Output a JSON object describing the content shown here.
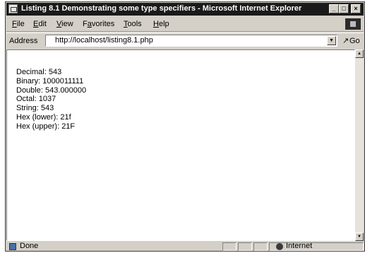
{
  "window": {
    "title": "Listing 8.1 Demonstrating some type specifiers - Microsoft Internet Explorer",
    "controls": {
      "minimize": "_",
      "maximize": "□",
      "close": "×"
    }
  },
  "menu": [
    {
      "label": "File",
      "mnemonic": "F",
      "rest": "ile"
    },
    {
      "label": "Edit",
      "mnemonic": "E",
      "rest": "dit"
    },
    {
      "label": "View",
      "mnemonic": "V",
      "rest": "iew"
    },
    {
      "label": "Favorites",
      "mnemonic": "a",
      "pre": "F",
      "rest": "vorites"
    },
    {
      "label": "Tools",
      "mnemonic": "T",
      "rest": "ools"
    },
    {
      "label": "Help",
      "mnemonic": "H",
      "rest": "elp"
    }
  ],
  "address": {
    "label": "Address",
    "url": "http://localhost/listing8.1.php",
    "go_label": "Go"
  },
  "output_lines": [
    "Decimal: 543",
    "Binary: 1000011111",
    "Double: 543.000000",
    "Octal: 1037",
    "String: 543",
    "Hex (lower): 21f",
    "Hex (upper): 21F"
  ],
  "status": {
    "text": "Done",
    "zone": "Internet"
  }
}
